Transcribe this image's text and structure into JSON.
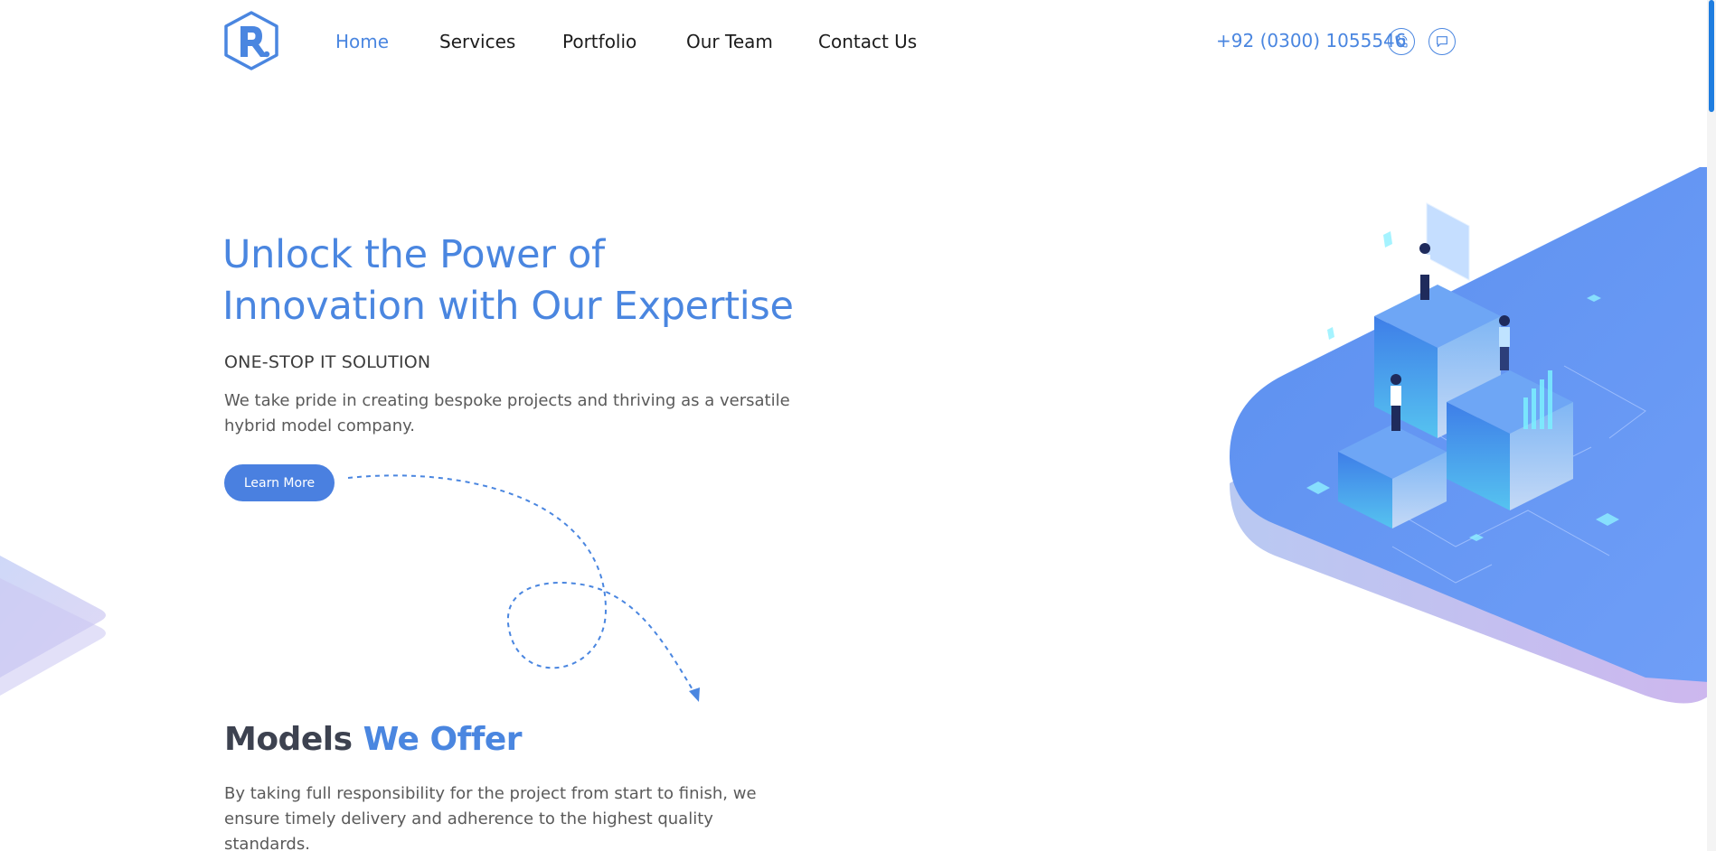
{
  "header": {
    "logo_icon": "hexagon-r-logo-icon",
    "nav": [
      {
        "label": "Home",
        "active": true
      },
      {
        "label": "Services",
        "active": false
      },
      {
        "label": "Portfolio",
        "active": false
      },
      {
        "label": "Our Team",
        "active": false
      },
      {
        "label": "Contact Us",
        "active": false
      }
    ],
    "phone": "+92 (0300) 1055546",
    "icons": [
      "phone-icon",
      "chat-icon"
    ]
  },
  "hero": {
    "title_line1": "Unlock the Power of",
    "title_line2": "Innovation with Our Expertise",
    "subtitle": "ONE-STOP IT SOLUTION",
    "description": "We take pride in creating bespoke projects and thriving as a versatile hybrid model company.",
    "button_label": "Learn More"
  },
  "models": {
    "title_main": "Models",
    "title_accent": "We Offer",
    "description": "By taking full responsibility for the project from start to finish, we ensure timely delivery and adherence to the highest quality standards."
  },
  "colors": {
    "accent": "#4a86e0",
    "button": "#4a80e0",
    "heading_dark": "#3d4250",
    "body_text": "#5a5a5a"
  }
}
